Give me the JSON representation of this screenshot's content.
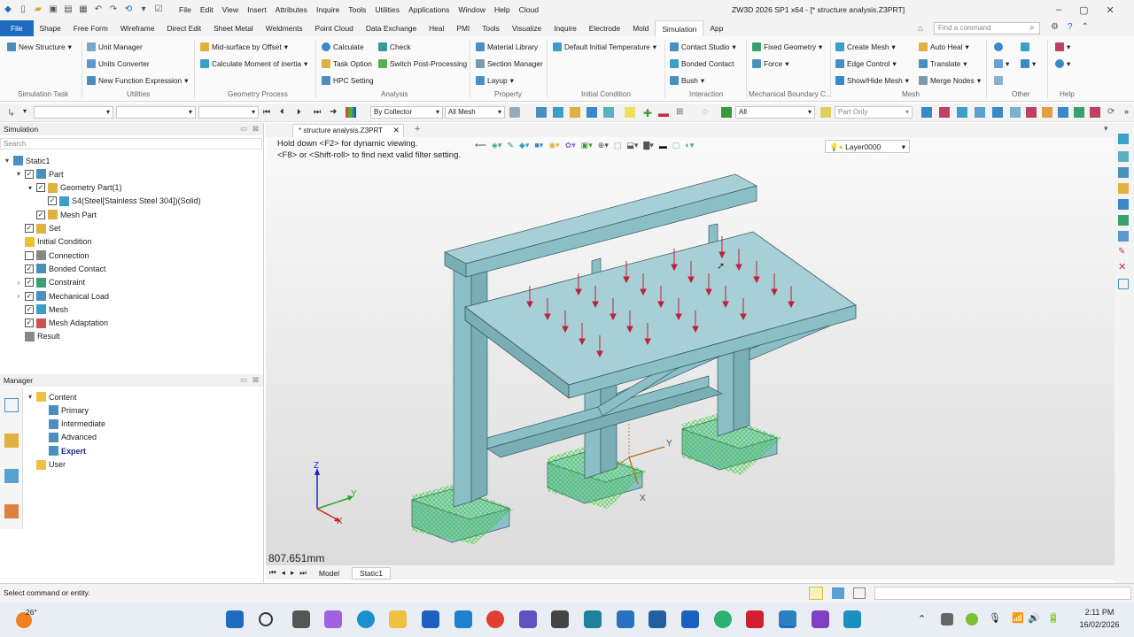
{
  "app": {
    "title": "ZW3D 2026 SP1 x64 - [* structure analysis.Z3PRT]",
    "menus": [
      "File",
      "Edit",
      "View",
      "Insert",
      "Attributes",
      "Inquire",
      "Tools",
      "Utilities",
      "Applications",
      "Window",
      "Help",
      "Cloud"
    ],
    "search_placeholder": "Find a command"
  },
  "tabs": [
    "File",
    "Shape",
    "Free Form",
    "Wireframe",
    "Direct Edit",
    "Sheet Metal",
    "Weldments",
    "Point Cloud",
    "Data Exchange",
    "Heal",
    "PMI",
    "Tools",
    "Visualize",
    "Inquire",
    "Electrode",
    "Mold",
    "Simulation",
    "App"
  ],
  "active_tab": "Simulation",
  "ribbon": {
    "groups": [
      "Simulation Task",
      "Utilities",
      "Geometry Process",
      "Analysis",
      "Property",
      "Initial Condition",
      "Interaction",
      "Mechanical Boundary C...",
      "Mesh",
      "Other",
      "Help"
    ],
    "new_structure": "New Structure",
    "unit_manager": "Unit Manager",
    "units_converter": "Units Converter",
    "new_function": "New Function Expression",
    "midsurface": "Mid-surface by Offset",
    "calc_moment": "Calculate Moment of inertia",
    "calculate": "Calculate",
    "check": "Check",
    "task_option": "Task Option",
    "switch_post": "Switch Post-Processing",
    "hpc_setting": "HPC Setting",
    "material_library": "Material Library",
    "section_manager": "Section Manager",
    "layup": "Layup",
    "default_temp": "Default Initial Temperature",
    "contact_studio": "Contact Studio",
    "bonded_contact": "Bonded Contact",
    "bush": "Bush",
    "fixed_geometry": "Fixed Geometry",
    "force": "Force",
    "create_mesh": "Create Mesh",
    "edge_control": "Edge Control",
    "show_hide_mesh": "Show/Hide Mesh",
    "auto_heal": "Auto Heal",
    "translate": "Translate",
    "merge_nodes": "Merge Nodes"
  },
  "toolbar2": {
    "collector": "By Collector",
    "mesh_filter": "All Mesh",
    "all": "All",
    "part_only": "Part Only"
  },
  "simulation_panel": {
    "title": "Simulation",
    "search": "Search",
    "tree": [
      {
        "label": "Static1",
        "level": 0,
        "exp": "▾",
        "cb": null,
        "color": "#4a8fc0"
      },
      {
        "label": "Part",
        "level": 1,
        "exp": "▾",
        "cb": "✓",
        "color": "#4a8fc0"
      },
      {
        "label": "Geometry Part(1)",
        "level": 2,
        "exp": "▾",
        "cb": "✓",
        "color": "#e0b040"
      },
      {
        "label": "S4(Steel[Stainless Steel 304])(Solid)",
        "level": 3,
        "exp": "",
        "cb": "✓",
        "color": "#3aa0c8"
      },
      {
        "label": "Mesh Part",
        "level": 2,
        "exp": "",
        "cb": "✓",
        "color": "#e0b040"
      },
      {
        "label": "Set",
        "level": 1,
        "exp": "",
        "cb": "✓",
        "color": "#e0b040"
      },
      {
        "label": "Initial Condition",
        "level": 1,
        "exp": "",
        "cb": null,
        "color": "#f0c030"
      },
      {
        "label": "Connection",
        "level": 1,
        "exp": "",
        "cb": " ",
        "color": "#888888"
      },
      {
        "label": "Bonded Contact",
        "level": 1,
        "exp": "",
        "cb": "✓",
        "color": "#4a8fc0"
      },
      {
        "label": "Constraint",
        "level": 1,
        "exp": "›",
        "cb": "✓",
        "color": "#3aa070"
      },
      {
        "label": "Mechanical Load",
        "level": 1,
        "exp": "›",
        "cb": "✓",
        "color": "#4a8fc0"
      },
      {
        "label": "Mesh",
        "level": 1,
        "exp": "",
        "cb": "✓",
        "color": "#3aa0c8"
      },
      {
        "label": "Mesh Adaptation",
        "level": 1,
        "exp": "",
        "cb": "✓",
        "color": "#d05050"
      },
      {
        "label": "Result",
        "level": 1,
        "exp": "",
        "cb": null,
        "color": "#888888"
      }
    ]
  },
  "manager_panel": {
    "title": "Manager",
    "tree": [
      {
        "label": "Content",
        "level": 0,
        "exp": "▾",
        "bold": false
      },
      {
        "label": "Primary",
        "level": 1,
        "exp": "",
        "bold": false
      },
      {
        "label": "Intermediate",
        "level": 1,
        "exp": "",
        "bold": false
      },
      {
        "label": "Advanced",
        "level": 1,
        "exp": "",
        "bold": false
      },
      {
        "label": "Expert",
        "level": 1,
        "exp": "",
        "bold": true
      },
      {
        "label": "User",
        "level": 0,
        "exp": "",
        "bold": false
      }
    ]
  },
  "document_tab": "* structure analysis.Z3PRT",
  "viewport": {
    "hint1": "Hold down <F2> for dynamic viewing.",
    "hint2": "<F8> or <Shift-roll> to find next valid filter setting.",
    "layer": "Layer0000",
    "distance": "807.651mm",
    "axis_x": "X",
    "axis_y": "Y",
    "axis_z": "Z"
  },
  "bottom_tabs": [
    "Model",
    "Static1"
  ],
  "status": "Select command or entity.",
  "taskbar": {
    "temp": "26°",
    "time": "2:11 PM",
    "date": "16/02/2026"
  },
  "colors": {
    "accent": "#1e6bc0",
    "model": "#8bbfc6",
    "load": "#c0203a",
    "fixture": "#33cc33"
  }
}
